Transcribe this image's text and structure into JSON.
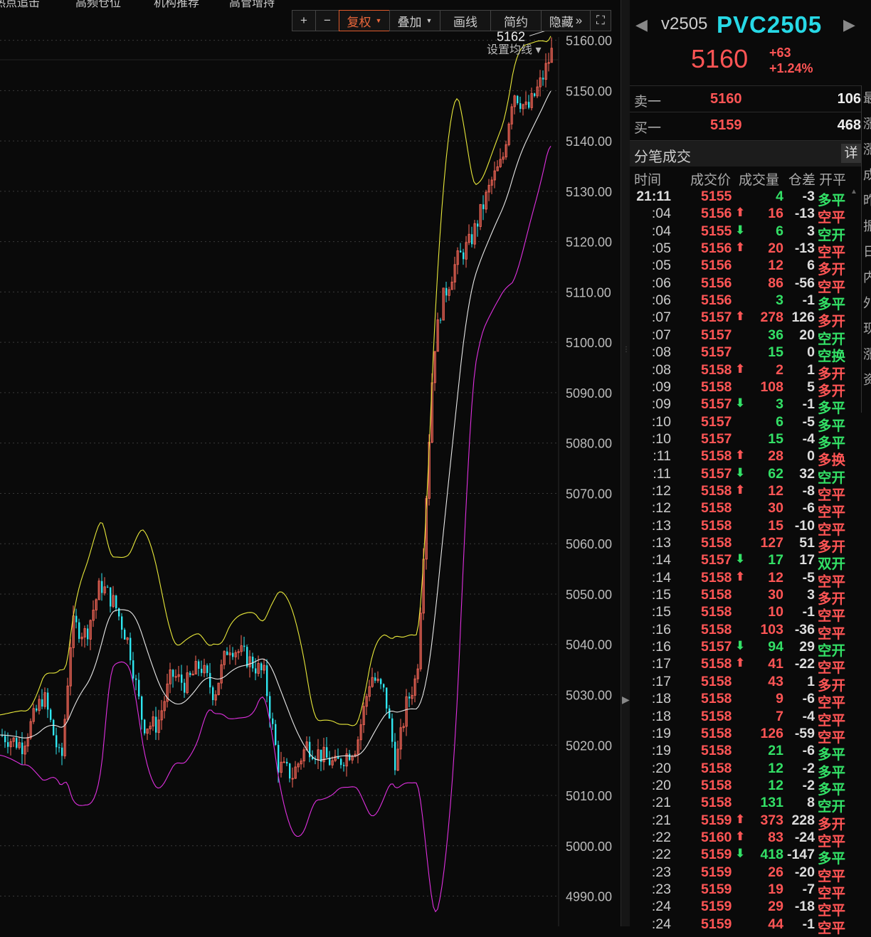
{
  "top_nav": [
    "热点追击",
    "高频仓位",
    "机构推荐",
    "高管增持"
  ],
  "toolbar": {
    "zoom_in": "+",
    "zoom_out": "−",
    "adjust_label": "复权",
    "overlay_label": "叠加",
    "draw_label": "画线",
    "simple_label": "简约",
    "hide_label": "隐藏",
    "hide_chevron": "»",
    "fullscreen_icon": "⛶",
    "ma_setting_label": "设置均线 ▾"
  },
  "colors": {
    "up": "#ff5555",
    "down": "#33e066",
    "candle_up": "#ff6a5a",
    "candle_down": "#2fe6f0",
    "boll_upper": "#e8e83a",
    "boll_mid": "#e8e8e8",
    "boll_lower": "#e030e0",
    "name": "#27d9e6"
  },
  "chart_data": {
    "type": "candlestick",
    "y_axis_ticks": [
      "5160.00",
      "5150.00",
      "5140.00",
      "5130.00",
      "5120.00",
      "5110.00",
      "5100.00",
      "5090.00",
      "5080.00",
      "5070.00",
      "5060.00",
      "5050.00",
      "5040.00",
      "5030.00",
      "5020.00",
      "5010.00",
      "5000.00",
      "4990.00"
    ],
    "ylim": [
      4984,
      5168
    ],
    "high_annotation": "5162",
    "high_value": 5162
  },
  "quote": {
    "code": "v2505",
    "name": "PVC2505",
    "price": "5160",
    "change": "+63",
    "change_pct": "+1.24%"
  },
  "order_book": [
    {
      "label": "卖一",
      "price": "5160",
      "qty": "106"
    },
    {
      "label": "买一",
      "price": "5159",
      "qty": "468"
    }
  ],
  "ticks_panel": {
    "title": "分笔成交",
    "detail_btn": "详",
    "columns": [
      "时间",
      "成交价",
      "成交量",
      "仓差",
      "开平"
    ]
  },
  "ticks": [
    {
      "time": "21:11",
      "price": "5155",
      "arrow": "",
      "vol": "4",
      "oi": "-3",
      "type": "多平",
      "pc": "red",
      "vc": "green",
      "tc": "green"
    },
    {
      "time": ":04",
      "price": "5156",
      "arrow": "up",
      "vol": "16",
      "oi": "-13",
      "type": "空平",
      "pc": "red",
      "vc": "red",
      "tc": "red"
    },
    {
      "time": ":04",
      "price": "5155",
      "arrow": "down",
      "vol": "6",
      "oi": "3",
      "type": "空开",
      "pc": "red",
      "vc": "green",
      "tc": "green"
    },
    {
      "time": ":05",
      "price": "5156",
      "arrow": "up",
      "vol": "20",
      "oi": "-13",
      "type": "空平",
      "pc": "red",
      "vc": "red",
      "tc": "red"
    },
    {
      "time": ":05",
      "price": "5156",
      "arrow": "",
      "vol": "12",
      "oi": "6",
      "type": "多开",
      "pc": "red",
      "vc": "red",
      "tc": "red"
    },
    {
      "time": ":06",
      "price": "5156",
      "arrow": "",
      "vol": "86",
      "oi": "-56",
      "type": "空平",
      "pc": "red",
      "vc": "red",
      "tc": "red"
    },
    {
      "time": ":06",
      "price": "5156",
      "arrow": "",
      "vol": "3",
      "oi": "-1",
      "type": "多平",
      "pc": "red",
      "vc": "green",
      "tc": "green"
    },
    {
      "time": ":07",
      "price": "5157",
      "arrow": "up",
      "vol": "278",
      "oi": "126",
      "type": "多开",
      "pc": "red",
      "vc": "red",
      "tc": "red"
    },
    {
      "time": ":07",
      "price": "5157",
      "arrow": "",
      "vol": "36",
      "oi": "20",
      "type": "空开",
      "pc": "red",
      "vc": "green",
      "tc": "green"
    },
    {
      "time": ":08",
      "price": "5157",
      "arrow": "",
      "vol": "15",
      "oi": "0",
      "type": "空换",
      "pc": "red",
      "vc": "green",
      "tc": "green"
    },
    {
      "time": ":08",
      "price": "5158",
      "arrow": "up",
      "vol": "2",
      "oi": "1",
      "type": "多开",
      "pc": "red",
      "vc": "red",
      "tc": "red"
    },
    {
      "time": ":09",
      "price": "5158",
      "arrow": "",
      "vol": "108",
      "oi": "5",
      "type": "多开",
      "pc": "red",
      "vc": "red",
      "tc": "red"
    },
    {
      "time": ":09",
      "price": "5157",
      "arrow": "down",
      "vol": "3",
      "oi": "-1",
      "type": "多平",
      "pc": "red",
      "vc": "green",
      "tc": "green"
    },
    {
      "time": ":10",
      "price": "5157",
      "arrow": "",
      "vol": "6",
      "oi": "-5",
      "type": "多平",
      "pc": "red",
      "vc": "green",
      "tc": "green"
    },
    {
      "time": ":10",
      "price": "5157",
      "arrow": "",
      "vol": "15",
      "oi": "-4",
      "type": "多平",
      "pc": "red",
      "vc": "green",
      "tc": "green"
    },
    {
      "time": ":11",
      "price": "5158",
      "arrow": "up",
      "vol": "28",
      "oi": "0",
      "type": "多换",
      "pc": "red",
      "vc": "red",
      "tc": "red"
    },
    {
      "time": ":11",
      "price": "5157",
      "arrow": "down",
      "vol": "62",
      "oi": "32",
      "type": "空开",
      "pc": "red",
      "vc": "green",
      "tc": "green"
    },
    {
      "time": ":12",
      "price": "5158",
      "arrow": "up",
      "vol": "12",
      "oi": "-8",
      "type": "空平",
      "pc": "red",
      "vc": "red",
      "tc": "red"
    },
    {
      "time": ":12",
      "price": "5158",
      "arrow": "",
      "vol": "30",
      "oi": "-6",
      "type": "空平",
      "pc": "red",
      "vc": "red",
      "tc": "red"
    },
    {
      "time": ":13",
      "price": "5158",
      "arrow": "",
      "vol": "15",
      "oi": "-10",
      "type": "空平",
      "pc": "red",
      "vc": "red",
      "tc": "red"
    },
    {
      "time": ":13",
      "price": "5158",
      "arrow": "",
      "vol": "127",
      "oi": "51",
      "type": "多开",
      "pc": "red",
      "vc": "red",
      "tc": "red"
    },
    {
      "time": ":14",
      "price": "5157",
      "arrow": "down",
      "vol": "17",
      "oi": "17",
      "type": "双开",
      "pc": "red",
      "vc": "green",
      "tc": "green"
    },
    {
      "time": ":14",
      "price": "5158",
      "arrow": "up",
      "vol": "12",
      "oi": "-5",
      "type": "空平",
      "pc": "red",
      "vc": "red",
      "tc": "red"
    },
    {
      "time": ":15",
      "price": "5158",
      "arrow": "",
      "vol": "30",
      "oi": "3",
      "type": "多开",
      "pc": "red",
      "vc": "red",
      "tc": "red"
    },
    {
      "time": ":15",
      "price": "5158",
      "arrow": "",
      "vol": "10",
      "oi": "-1",
      "type": "空平",
      "pc": "red",
      "vc": "red",
      "tc": "red"
    },
    {
      "time": ":16",
      "price": "5158",
      "arrow": "",
      "vol": "103",
      "oi": "-36",
      "type": "空平",
      "pc": "red",
      "vc": "red",
      "tc": "red"
    },
    {
      "time": ":16",
      "price": "5157",
      "arrow": "down",
      "vol": "94",
      "oi": "29",
      "type": "空开",
      "pc": "red",
      "vc": "green",
      "tc": "green"
    },
    {
      "time": ":17",
      "price": "5158",
      "arrow": "up",
      "vol": "41",
      "oi": "-22",
      "type": "空平",
      "pc": "red",
      "vc": "red",
      "tc": "red"
    },
    {
      "time": ":17",
      "price": "5158",
      "arrow": "",
      "vol": "43",
      "oi": "1",
      "type": "多开",
      "pc": "red",
      "vc": "red",
      "tc": "red"
    },
    {
      "time": ":18",
      "price": "5158",
      "arrow": "",
      "vol": "9",
      "oi": "-6",
      "type": "空平",
      "pc": "red",
      "vc": "red",
      "tc": "red"
    },
    {
      "time": ":18",
      "price": "5158",
      "arrow": "",
      "vol": "7",
      "oi": "-4",
      "type": "空平",
      "pc": "red",
      "vc": "red",
      "tc": "red"
    },
    {
      "time": ":19",
      "price": "5158",
      "arrow": "",
      "vol": "126",
      "oi": "-59",
      "type": "空平",
      "pc": "red",
      "vc": "red",
      "tc": "red"
    },
    {
      "time": ":19",
      "price": "5158",
      "arrow": "",
      "vol": "21",
      "oi": "-6",
      "type": "多平",
      "pc": "red",
      "vc": "green",
      "tc": "green"
    },
    {
      "time": ":20",
      "price": "5158",
      "arrow": "",
      "vol": "12",
      "oi": "-2",
      "type": "多平",
      "pc": "red",
      "vc": "green",
      "tc": "green"
    },
    {
      "time": ":20",
      "price": "5158",
      "arrow": "",
      "vol": "12",
      "oi": "-2",
      "type": "多平",
      "pc": "red",
      "vc": "green",
      "tc": "green"
    },
    {
      "time": ":21",
      "price": "5158",
      "arrow": "",
      "vol": "131",
      "oi": "8",
      "type": "空开",
      "pc": "red",
      "vc": "green",
      "tc": "green"
    },
    {
      "time": ":21",
      "price": "5159",
      "arrow": "up",
      "vol": "373",
      "oi": "228",
      "type": "多开",
      "pc": "red",
      "vc": "red",
      "tc": "red"
    },
    {
      "time": ":22",
      "price": "5160",
      "arrow": "up",
      "vol": "83",
      "oi": "-24",
      "type": "空平",
      "pc": "red",
      "vc": "red",
      "tc": "red"
    },
    {
      "time": ":22",
      "price": "5159",
      "arrow": "down",
      "vol": "418",
      "oi": "-147",
      "type": "多平",
      "pc": "red",
      "vc": "green",
      "tc": "green"
    },
    {
      "time": ":23",
      "price": "5159",
      "arrow": "",
      "vol": "26",
      "oi": "-20",
      "type": "空平",
      "pc": "red",
      "vc": "red",
      "tc": "red"
    },
    {
      "time": ":23",
      "price": "5159",
      "arrow": "",
      "vol": "19",
      "oi": "-7",
      "type": "空平",
      "pc": "red",
      "vc": "red",
      "tc": "red"
    },
    {
      "time": ":24",
      "price": "5159",
      "arrow": "",
      "vol": "29",
      "oi": "-18",
      "type": "空平",
      "pc": "red",
      "vc": "red",
      "tc": "red"
    },
    {
      "time": ":24",
      "price": "5159",
      "arrow": "",
      "vol": "44",
      "oi": "-1",
      "type": "空平",
      "pc": "red",
      "vc": "red",
      "tc": "red"
    }
  ],
  "edge_labels": [
    "最",
    "涨",
    "涨",
    "成",
    "昨",
    "振",
    "日",
    "内",
    "外",
    "现",
    "涨",
    "资"
  ]
}
